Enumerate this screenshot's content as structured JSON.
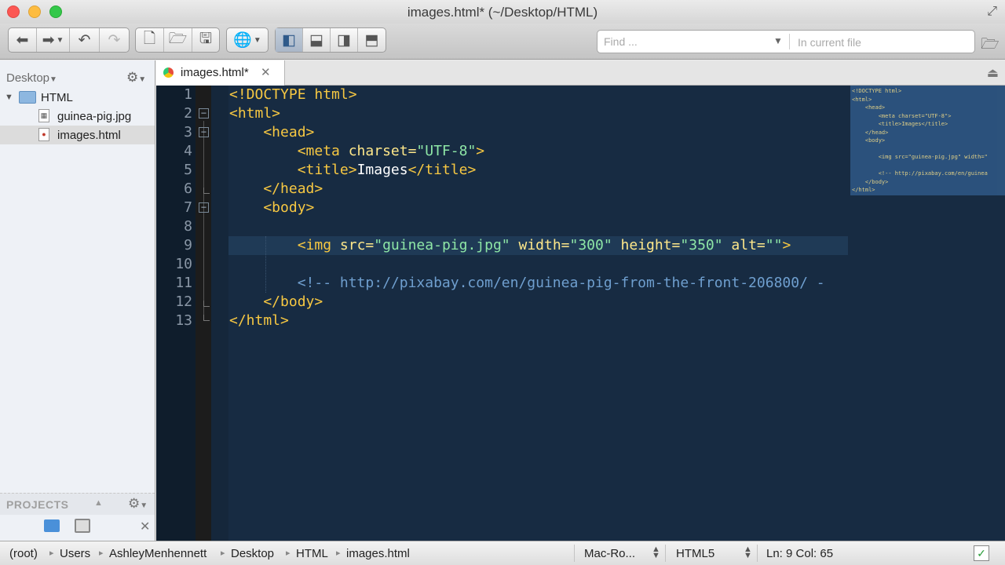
{
  "window": {
    "title": "images.html* (~/Desktop/HTML)"
  },
  "toolbar": {
    "back_icon": "arrow-left-icon",
    "forward_icon": "arrow-right-icon",
    "undo_icon": "undo-icon",
    "redo_icon": "redo-icon",
    "new_file_icon": "new-file-icon",
    "open_icon": "open-folder-icon",
    "save_icon": "save-icon",
    "preview_icon": "globe-icon"
  },
  "find": {
    "placeholder": "Find ...",
    "scope_placeholder": "In current file"
  },
  "sidebar": {
    "header": "Desktop",
    "root_folder": "HTML",
    "files": [
      {
        "label": "guinea-pig.jpg",
        "selected": false
      },
      {
        "label": "images.html",
        "selected": true
      }
    ],
    "projects_label": "PROJECTS"
  },
  "tabs": [
    {
      "label": "images.html*",
      "close": "✕"
    }
  ],
  "editor": {
    "line_numbers": [
      "1",
      "2",
      "3",
      "4",
      "5",
      "6",
      "7",
      "8",
      "9",
      "10",
      "11",
      "12",
      "13"
    ],
    "current_line": 9,
    "lines": [
      [
        {
          "t": "tag",
          "v": "<!DOCTYPE html>"
        }
      ],
      [
        {
          "t": "tag",
          "v": "<html>"
        }
      ],
      [
        {
          "t": "tag",
          "v": "    <head>"
        }
      ],
      [
        {
          "t": "tag",
          "v": "        <meta "
        },
        {
          "t": "attr",
          "v": "charset="
        },
        {
          "t": "str",
          "v": "\"UTF-8\""
        },
        {
          "t": "tag",
          "v": ">"
        }
      ],
      [
        {
          "t": "tag",
          "v": "        <title>"
        },
        {
          "t": "txt",
          "v": "Images"
        },
        {
          "t": "tag",
          "v": "</title>"
        }
      ],
      [
        {
          "t": "tag",
          "v": "    </head>"
        }
      ],
      [
        {
          "t": "tag",
          "v": "    <body>"
        }
      ],
      [
        {
          "t": "txt",
          "v": ""
        }
      ],
      [
        {
          "t": "tag",
          "v": "        <img "
        },
        {
          "t": "attr",
          "v": "src="
        },
        {
          "t": "str",
          "v": "\"guinea-pig.jpg\""
        },
        {
          "t": "attr",
          "v": " width="
        },
        {
          "t": "str",
          "v": "\"300\""
        },
        {
          "t": "attr",
          "v": " height="
        },
        {
          "t": "str",
          "v": "\"350\""
        },
        {
          "t": "attr",
          "v": " alt="
        },
        {
          "t": "str",
          "v": "\"\""
        },
        {
          "t": "tag",
          "v": ">"
        }
      ],
      [
        {
          "t": "txt",
          "v": ""
        }
      ],
      [
        {
          "t": "cmt",
          "v": "        <!-- http://pixabay.com/en/guinea-pig-from-the-front-206800/ -"
        }
      ],
      [
        {
          "t": "tag",
          "v": "    </body>"
        }
      ],
      [
        {
          "t": "tag",
          "v": "</html>"
        }
      ]
    ]
  },
  "minimap": {
    "lines": [
      "<!DOCTYPE html>",
      "<html>",
      "    <head>",
      "        <meta charset=\"UTF-8\">",
      "        <title>Images</title>",
      "    </head>",
      "    <body>",
      "",
      "        <img src=\"guinea-pig.jpg\" width=\"",
      "",
      "        <!-- http://pixabay.com/en/guinea",
      "    </body>",
      "</html>"
    ]
  },
  "statusbar": {
    "breadcrumb": [
      "(root)",
      "Users",
      "AshleyMenhennett",
      "Desktop",
      "HTML",
      "images.html"
    ],
    "encoding": "Mac-Ro...",
    "doctype": "HTML5",
    "position": "Ln: 9 Col: 65"
  }
}
